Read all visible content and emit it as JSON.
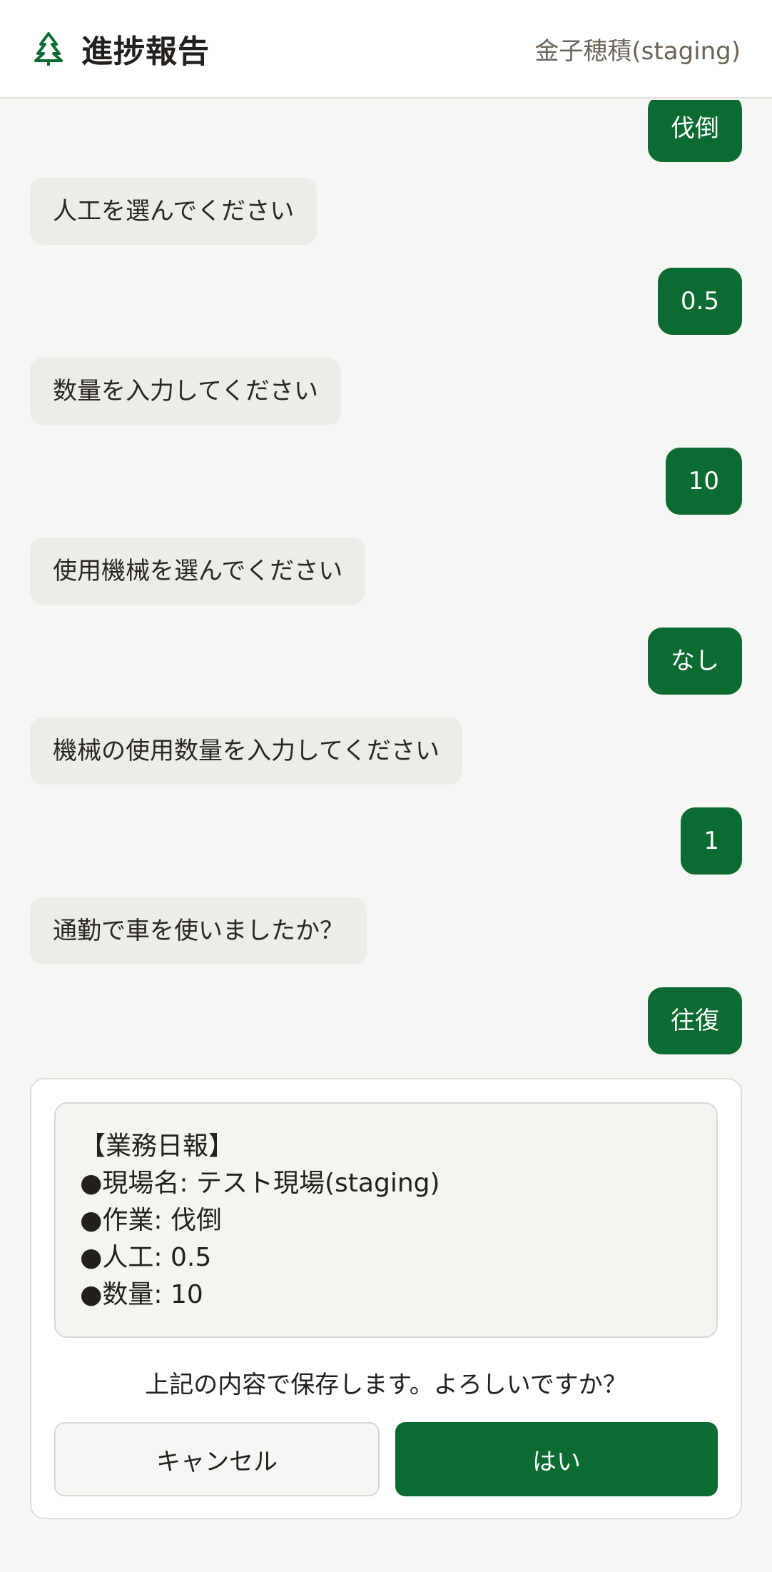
{
  "header": {
    "title": "進捗報告",
    "user": "金子穂積(staging)",
    "logo_icon": "tree-icon"
  },
  "messages": [
    {
      "role": "user",
      "text": "伐倒"
    },
    {
      "role": "bot",
      "text": "人工を選んでください"
    },
    {
      "role": "user",
      "text": "0.5"
    },
    {
      "role": "bot",
      "text": "数量を入力してください"
    },
    {
      "role": "user",
      "text": "10"
    },
    {
      "role": "bot",
      "text": "使用機械を選んでください"
    },
    {
      "role": "user",
      "text": "なし"
    },
    {
      "role": "bot",
      "text": "機械の使用数量を入力してください"
    },
    {
      "role": "user",
      "text": "1"
    },
    {
      "role": "bot",
      "text": "通勤で車を使いましたか？"
    },
    {
      "role": "user",
      "text": "往復"
    }
  ],
  "confirm": {
    "report_lines": [
      "【業務日報】",
      "●現場名: テスト現場(staging)",
      "●作業: 伐倒",
      "●人工: 0.5",
      "●数量: 10"
    ],
    "question": "上記の内容で保存します。よろしいですか？",
    "cancel_label": "キャンセル",
    "yes_label": "はい"
  },
  "colors": {
    "brand_green": "#0b6b30",
    "bot_bubble": "#ecede8",
    "background": "#f6f7f4"
  }
}
